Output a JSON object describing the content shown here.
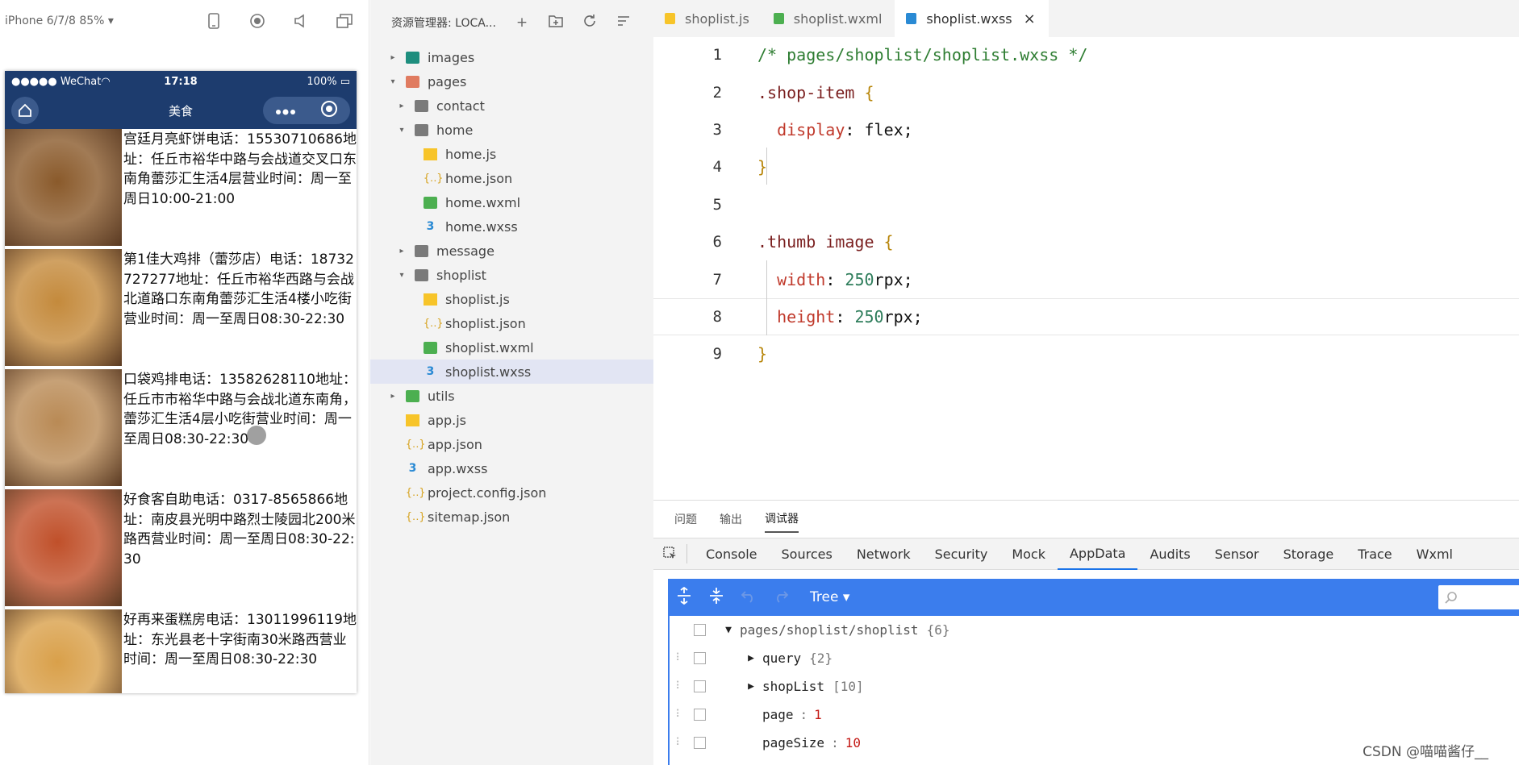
{
  "simulator": {
    "device": "iPhone 6/7/8 85% ▾",
    "status_left": "●●●●● WeChat◠",
    "status_time": "17:18",
    "status_right": "100% ▭",
    "nav_title": "美食",
    "shops": [
      {
        "text": "宫廷月亮虾饼电话：15530710686地址：任丘市裕华中路与会战道交叉口东南角蕾莎汇生活4层营业时间：周一至周日10:00-21:00",
        "color": "#8a5a2b"
      },
      {
        "text": "第1佳大鸡排（蕾莎店）电话：18732727277地址：任丘市裕华西路与会战北道路口东南角蕾莎汇生活4楼小吃街营业时间：周一至周日08:30-22:30",
        "color": "#c48a3c"
      },
      {
        "text": "口袋鸡排电话：13582628110地址：任丘市市裕华中路与会战北道东南角，蕾莎汇生活4层小吃街营业时间：周一至周日08:30-22:30",
        "color": "#b98a55"
      },
      {
        "text": "好食客自助电话：0317-8565866地址：南皮县光明中路烈士陵园北200米路西营业时间：周一至周日08:30-22:30",
        "color": "#c0502a"
      },
      {
        "text": "好再来蛋糕房电话：13011996119地址：东光县老十字街南30米路西营业时间：周一至周日08:30-22:30",
        "color": "#d9a04a"
      }
    ]
  },
  "explorer": {
    "title": "资源管理器: LOCA...",
    "tree": [
      {
        "label": "images",
        "depth": 0,
        "arrow": "▸",
        "icon": "folder-img"
      },
      {
        "label": "pages",
        "depth": 0,
        "arrow": "▾",
        "icon": "folder-pages"
      },
      {
        "label": "contact",
        "depth": 1,
        "arrow": "▸",
        "icon": "folder"
      },
      {
        "label": "home",
        "depth": 1,
        "arrow": "▾",
        "icon": "folder"
      },
      {
        "label": "home.js",
        "depth": 2,
        "arrow": "",
        "icon": "js"
      },
      {
        "label": "home.json",
        "depth": 2,
        "arrow": "",
        "icon": "json"
      },
      {
        "label": "home.wxml",
        "depth": 2,
        "arrow": "",
        "icon": "wxml"
      },
      {
        "label": "home.wxss",
        "depth": 2,
        "arrow": "",
        "icon": "wxss"
      },
      {
        "label": "message",
        "depth": 1,
        "arrow": "▸",
        "icon": "folder"
      },
      {
        "label": "shoplist",
        "depth": 1,
        "arrow": "▾",
        "icon": "folder"
      },
      {
        "label": "shoplist.js",
        "depth": 2,
        "arrow": "",
        "icon": "js"
      },
      {
        "label": "shoplist.json",
        "depth": 2,
        "arrow": "",
        "icon": "json"
      },
      {
        "label": "shoplist.wxml",
        "depth": 2,
        "arrow": "",
        "icon": "wxml"
      },
      {
        "label": "shoplist.wxss",
        "depth": 2,
        "arrow": "",
        "icon": "wxss",
        "selected": true
      },
      {
        "label": "utils",
        "depth": 0,
        "arrow": "▸",
        "icon": "folder-utils"
      },
      {
        "label": "app.js",
        "depth": 0,
        "arrow": "",
        "icon": "js"
      },
      {
        "label": "app.json",
        "depth": 0,
        "arrow": "",
        "icon": "json"
      },
      {
        "label": "app.wxss",
        "depth": 0,
        "arrow": "",
        "icon": "wxss"
      },
      {
        "label": "project.config.json",
        "depth": 0,
        "arrow": "",
        "icon": "json"
      },
      {
        "label": "sitemap.json",
        "depth": 0,
        "arrow": "",
        "icon": "json"
      }
    ]
  },
  "editor": {
    "tabs": [
      {
        "label": "shoplist.js",
        "icon": "js"
      },
      {
        "label": "shoplist.wxml",
        "icon": "wxml"
      },
      {
        "label": "shoplist.wxss",
        "icon": "wxss",
        "active": true
      }
    ],
    "lines": [
      {
        "n": "1",
        "parts": [
          [
            "c-comment",
            "/* pages/shoplist/shoplist.wxss */"
          ]
        ]
      },
      {
        "n": "2",
        "parts": [
          [
            "c-sel",
            ".shop-item "
          ],
          [
            "c-brace",
            "{"
          ]
        ]
      },
      {
        "n": "3",
        "parts": [
          [
            "c-plain",
            "  "
          ],
          [
            "c-prop",
            "display"
          ],
          [
            "c-plain",
            ": "
          ],
          [
            "c-plain",
            "flex;"
          ]
        ]
      },
      {
        "n": "4",
        "parts": [
          [
            "c-brace",
            "}"
          ]
        ]
      },
      {
        "n": "5",
        "parts": []
      },
      {
        "n": "6",
        "parts": [
          [
            "c-sel",
            ".thumb image "
          ],
          [
            "c-brace",
            "{"
          ]
        ]
      },
      {
        "n": "7",
        "parts": [
          [
            "c-plain",
            "  "
          ],
          [
            "c-prop",
            "width"
          ],
          [
            "c-plain",
            ": "
          ],
          [
            "c-num",
            "250"
          ],
          [
            "c-plain",
            "rpx;"
          ]
        ]
      },
      {
        "n": "8",
        "parts": [
          [
            "c-plain",
            "  "
          ],
          [
            "c-prop",
            "height"
          ],
          [
            "c-plain",
            ": "
          ],
          [
            "c-num",
            "250"
          ],
          [
            "c-plain",
            "rpx;"
          ]
        ],
        "highlight": true
      },
      {
        "n": "9",
        "parts": [
          [
            "c-brace",
            "}"
          ]
        ]
      }
    ]
  },
  "debug": {
    "panel_tabs": [
      "问题",
      "输出",
      "调试器"
    ],
    "devtools_tabs": [
      "Console",
      "Sources",
      "Network",
      "Security",
      "Mock",
      "AppData",
      "Audits",
      "Sensor",
      "Storage",
      "Trace",
      "Wxml"
    ],
    "active_devtools_tab": "AppData",
    "tree_label": "Tree ▾",
    "root": {
      "key": "pages/shoplist/shoplist",
      "meta": "{6}"
    },
    "rows": [
      {
        "key": "query",
        "meta": "{2}",
        "toggle": "▶"
      },
      {
        "key": "shopList",
        "meta": "[10]",
        "toggle": "▶"
      },
      {
        "key": "page",
        "value": "1"
      },
      {
        "key": "pageSize",
        "value": "10"
      }
    ]
  },
  "watermark": "CSDN @喵喵酱仔__"
}
